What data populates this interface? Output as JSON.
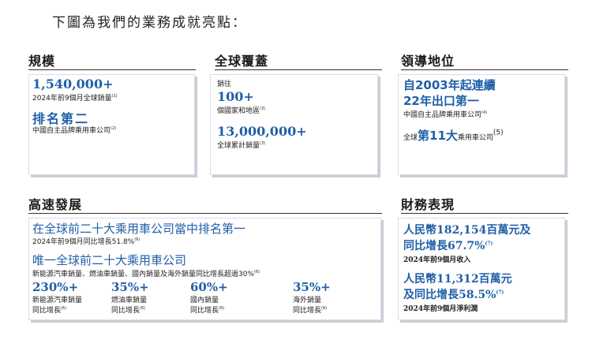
{
  "intro": "下圖為我們的業務成就亮點：",
  "scale": {
    "title": "規模",
    "value": "1,540,000+",
    "value_caption": "2024年前9個月全球銷量",
    "value_note": "(1)",
    "rank": "排名第二",
    "rank_caption": "中國自主品牌乘用車公司",
    "rank_note": "(2)"
  },
  "coverage": {
    "title": "全球覆蓋",
    "label": "銷往",
    "countries": "100+",
    "countries_caption": "個國家和地區",
    "countries_note": "(3)",
    "cumulative": "13,000,000+",
    "cumulative_caption": "全球累計銷量",
    "cumulative_note": "(3)"
  },
  "leadership": {
    "title": "領導地位",
    "line1": "自2003年起連續",
    "line2": "22年出口第一",
    "line2_caption": "中國自主品牌乘用車公司",
    "line2_note": "(4)",
    "global_prefix": "全球",
    "global_rank": "第11大",
    "global_suffix": "乘用車公司",
    "global_note": "(5)"
  },
  "growth": {
    "title": "高速發展",
    "headline1": "在全球前二十大乘用車公司當中排名第一",
    "headline1_caption": "2024年前9個月同比增長51.8%",
    "headline1_note": "(6)",
    "headline2": "唯一全球前二十大乘用車公司",
    "headline2_caption": "新能源汽車銷量、燃油車銷量、國內銷量及海外銷量同比增長超過30%",
    "headline2_note": "(6)",
    "stats": [
      {
        "value": "230%+",
        "line1": "新能源汽車銷量",
        "line2": "同比增長",
        "note": "(6)"
      },
      {
        "value": "35%+",
        "line1": "燃油車銷量",
        "line2": "同比增長",
        "note": "(6)"
      },
      {
        "value": "60%+",
        "line1": "國內銷量",
        "line2": "同比增長",
        "note": "(6)"
      },
      {
        "value": "35%+",
        "line1": "海外銷量",
        "line2": "同比增長",
        "note": "(6)"
      }
    ]
  },
  "finance": {
    "title": "財務表現",
    "revenue_line1": "人民幣182,154百萬元及",
    "revenue_line2": "同比增長67.7%",
    "revenue_note": "(7)",
    "revenue_caption": "2024年前9個月收入",
    "profit_line1": "人民幣11,312百萬元",
    "profit_line2": "及同比增長58.5%",
    "profit_note": "(7)",
    "profit_caption": "2024年前9個月淨利潤"
  }
}
